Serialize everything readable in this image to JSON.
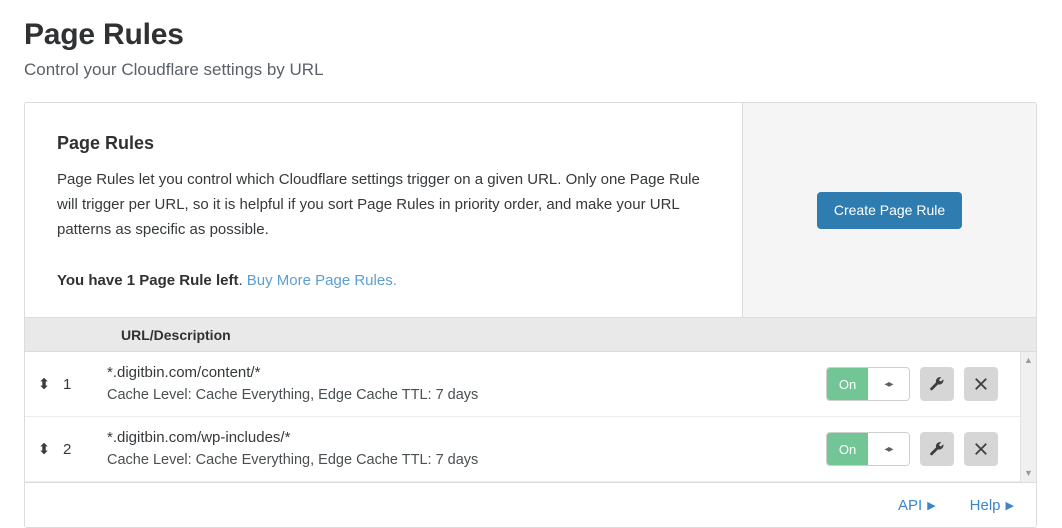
{
  "header": {
    "title": "Page Rules",
    "subtitle": "Control your Cloudflare settings by URL"
  },
  "intro": {
    "title": "Page Rules",
    "body": "Page Rules let you control which Cloudflare settings trigger on a given URL. Only one Page Rule will trigger per URL, so it is helpful if you sort Page Rules in priority order, and make your URL patterns as specific as possible.",
    "quota_bold": "You have 1 Page Rule left",
    "quota_period": ".",
    "buy_link": "Buy More Page Rules."
  },
  "aside": {
    "create_button": "Create Page Rule"
  },
  "table": {
    "columns": [
      "URL/Description"
    ],
    "rows": [
      {
        "rank": "1",
        "url": "*.digitbin.com/content/*",
        "settings": "Cache Level: Cache Everything, Edge Cache TTL: 7 days",
        "toggle_state": "On",
        "handle_glyph": "⬍",
        "knob_glyph": "◂▸"
      },
      {
        "rank": "2",
        "url": "*.digitbin.com/wp-includes/*",
        "settings": "Cache Level: Cache Everything, Edge Cache TTL: 7 days",
        "toggle_state": "On",
        "handle_glyph": "⬍",
        "knob_glyph": "◂▸"
      }
    ],
    "scrollbar": {
      "up": "▲",
      "down": "▼"
    }
  },
  "footer": {
    "api_label": "API",
    "api_caret": "▶",
    "help_label": "Help",
    "help_caret": "▶"
  },
  "colors": {
    "primary_button": "#2f7cb0",
    "toggle_on": "#72c695",
    "link": "#3a86c8",
    "buy_link": "#5b9ed4",
    "table_header_bg": "#e9e9e9",
    "aside_bg": "#f5f5f5"
  }
}
